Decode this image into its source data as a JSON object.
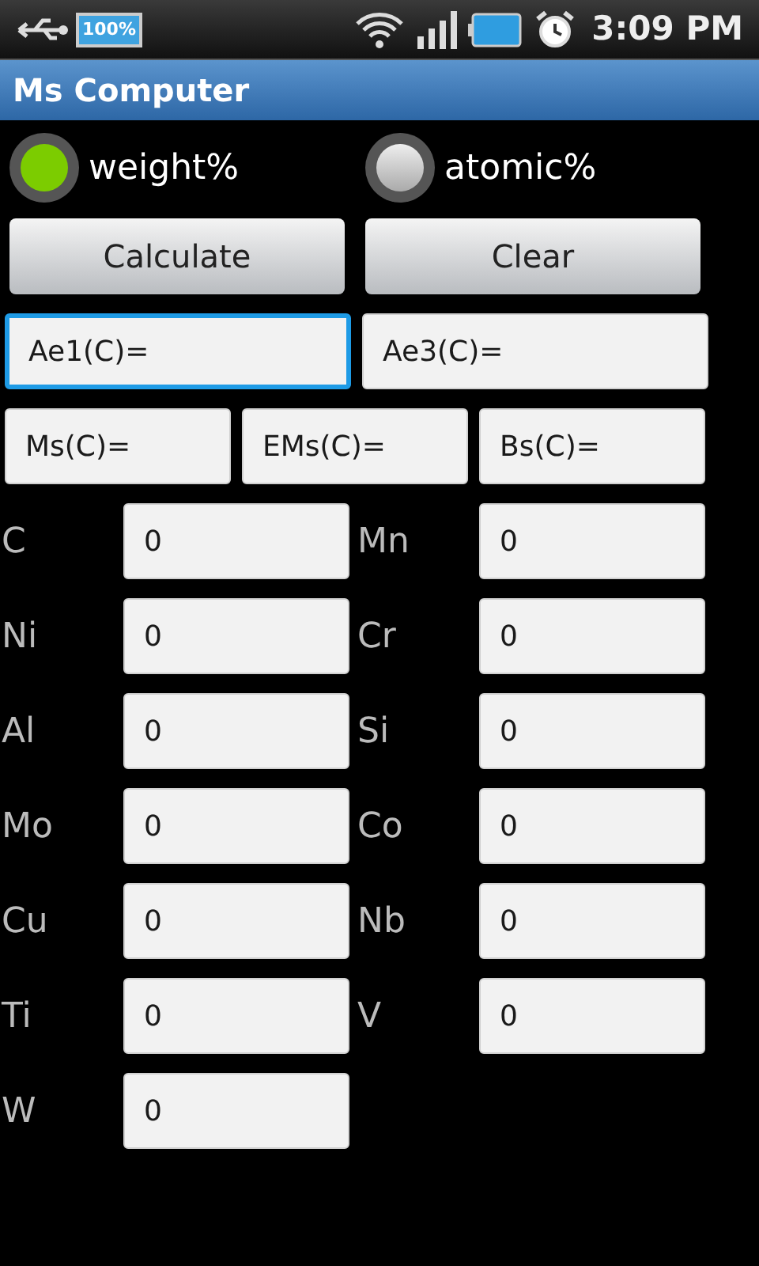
{
  "status_bar": {
    "battery_label": "100%",
    "time": "3:09 PM"
  },
  "window": {
    "title": "Ms Computer"
  },
  "units": [
    {
      "label": "weight%",
      "selected": true
    },
    {
      "label": "atomic%",
      "selected": false
    }
  ],
  "buttons": [
    "Calculate",
    "Clear"
  ],
  "results": [
    [
      {
        "value": "Ae1(C)=",
        "focused": true
      },
      {
        "value": "Ae3(C)=",
        "focused": false
      }
    ],
    [
      {
        "value": "Ms(C)=",
        "focused": false
      },
      {
        "value": "EMs(C)=",
        "focused": false
      },
      {
        "value": "Bs(C)=",
        "focused": false
      }
    ]
  ],
  "elements": [
    {
      "symbol": "C",
      "value": "0"
    },
    {
      "symbol": "Mn",
      "value": "0"
    },
    {
      "symbol": "Ni",
      "value": "0"
    },
    {
      "symbol": "Cr",
      "value": "0"
    },
    {
      "symbol": "Al",
      "value": "0"
    },
    {
      "symbol": "Si",
      "value": "0"
    },
    {
      "symbol": "Mo",
      "value": "0"
    },
    {
      "symbol": "Co",
      "value": "0"
    },
    {
      "symbol": "Cu",
      "value": "0"
    },
    {
      "symbol": "Nb",
      "value": "0"
    },
    {
      "symbol": "Ti",
      "value": "0"
    },
    {
      "symbol": "V",
      "value": "0"
    },
    {
      "symbol": "W",
      "value": "0"
    }
  ]
}
